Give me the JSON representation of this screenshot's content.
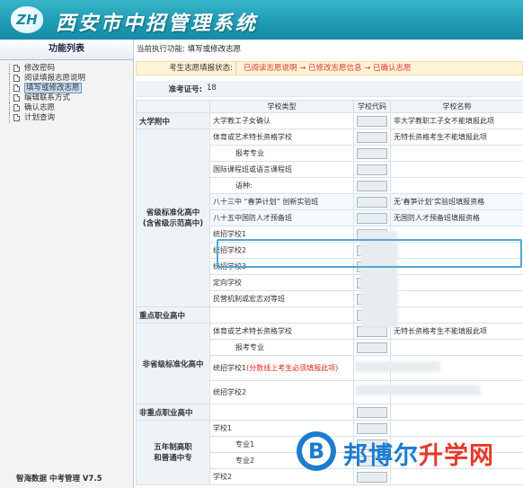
{
  "header": {
    "logo_text": "ZH",
    "system_title": "西安市中招管理系统"
  },
  "sidebar": {
    "title": "功能列表",
    "items": [
      {
        "label": "修改密码",
        "active": false
      },
      {
        "label": "阅读填报志愿说明",
        "active": false
      },
      {
        "label": "填写或修改志愿",
        "active": true
      },
      {
        "label": "编辑联系方式",
        "active": false
      },
      {
        "label": "确认志愿",
        "active": false
      },
      {
        "label": "计划查询",
        "active": false
      }
    ],
    "footer": "智海数据    中考管理 V7.5"
  },
  "main": {
    "current_function_label": "当前执行功能:",
    "current_function_value": "填写或修改志愿",
    "status_label": "考生志愿填报状态:",
    "status_steps": "已阅读志愿说明 → 已修改志愿信息 → 已确认志愿",
    "exam_label": "准考证号:",
    "exam_value": "18",
    "table": {
      "headers": [
        "学校类型",
        "学校代码",
        "学校名称"
      ],
      "rows": [
        {
          "cat": "大学附中",
          "type": "大学教工子女确认",
          "note": "非大学教职工子女不能填报此项"
        },
        {
          "cat": "省级标准化高中\n(含省级示范高中)",
          "type": "体育或艺术特长资格学校",
          "note": "无特长资格考生不能填报此项"
        },
        {
          "type": "报考专业",
          "note": ""
        },
        {
          "type": "国际课程班或语言课程班",
          "note": ""
        },
        {
          "type": "语种:",
          "note": ""
        },
        {
          "type": "八十三中 “春笋计划” 创新实验班",
          "note": "无‘春笋计划’实验班填报资格"
        },
        {
          "type": "八十五中国防人才预备班",
          "note": "无国防人才预备班填报资格"
        },
        {
          "type": "统招学校1",
          "note": ""
        },
        {
          "type": "统招学校2",
          "note": ""
        },
        {
          "type": "统招学校3",
          "note": ""
        },
        {
          "type": "定向学校",
          "note": ""
        },
        {
          "type": "民营机制或宏志对等班",
          "note": ""
        },
        {
          "cat": "重点职业高中",
          "type": "",
          "note": ""
        },
        {
          "cat": "非省级标准化高中",
          "type": "体育或艺术特长资格学校",
          "note": "无特长资格考生不能填报此项"
        },
        {
          "type": "报考专业",
          "note": ""
        },
        {
          "type": "统招学校1",
          "type_note": "(分数线上考生必须填报此项)",
          "note": ""
        },
        {
          "type": "统招学校2",
          "note": ""
        },
        {
          "cat": "非重点职业高中",
          "type": "",
          "note": ""
        },
        {
          "cat": "五年制高职\n和普通中专",
          "type": "学校1",
          "note": ""
        },
        {
          "type": "专业1",
          "note": ""
        },
        {
          "type": "专业2",
          "note": ""
        },
        {
          "type": "学校2",
          "note": ""
        }
      ]
    }
  },
  "watermark": {
    "glyph": "B",
    "text_a": "邦博尔",
    "text_b": "升学网"
  },
  "colors": {
    "header_blue": "#1f9cb5",
    "note_red": "#e0281d",
    "highlight_border": "#4ea7d9",
    "watermark_blue": "#1d7ccf",
    "watermark_red": "#e53a2a"
  }
}
